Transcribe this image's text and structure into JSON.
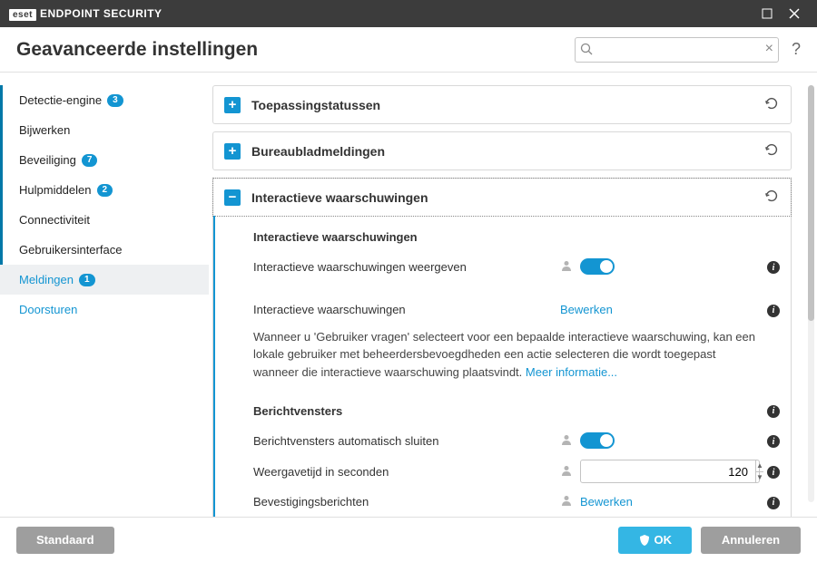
{
  "title": {
    "brand_prefix": "eset",
    "product": "ENDPOINT SECURITY"
  },
  "header": {
    "title": "Geavanceerde instellingen",
    "search_placeholder": ""
  },
  "sidebar": {
    "items": [
      {
        "label": "Detectie-engine",
        "badge": "3"
      },
      {
        "label": "Bijwerken",
        "badge": ""
      },
      {
        "label": "Beveiliging",
        "badge": "7"
      },
      {
        "label": "Hulpmiddelen",
        "badge": "2"
      },
      {
        "label": "Connectiviteit",
        "badge": ""
      },
      {
        "label": "Gebruikersinterface",
        "badge": ""
      },
      {
        "label": "Meldingen",
        "badge": "1"
      },
      {
        "label": "Doorsturen",
        "badge": ""
      }
    ]
  },
  "sections": [
    {
      "title": "Toepassingstatussen"
    },
    {
      "title": "Bureaubladmeldingen"
    },
    {
      "title": "Interactieve waarschuwingen",
      "sub1_heading": "Interactieve waarschuwingen",
      "row_show": "Interactieve waarschuwingen weergeven",
      "row_ia_label": "Interactieve waarschuwingen",
      "row_ia_action": "Bewerken",
      "desc_pre": "Wanneer u 'Gebruiker vragen' selecteert voor een bepaalde interactieve waarschuwing, kan een lokale gebruiker met beheerdersbevoegdheden een actie selecteren die wordt toegepast wanneer die interactieve waarschuwing plaatsvindt. ",
      "desc_link": "Meer informatie...",
      "sub2_heading": "Berichtvensters",
      "row_autoclose": "Berichtvensters automatisch sluiten",
      "row_timeout": "Weergavetijd in seconden",
      "row_timeout_value": "120",
      "row_confirm": "Bevestigingsberichten",
      "row_confirm_action": "Bewerken"
    }
  ],
  "footer": {
    "default": "Standaard",
    "ok": "OK",
    "cancel": "Annuleren"
  }
}
